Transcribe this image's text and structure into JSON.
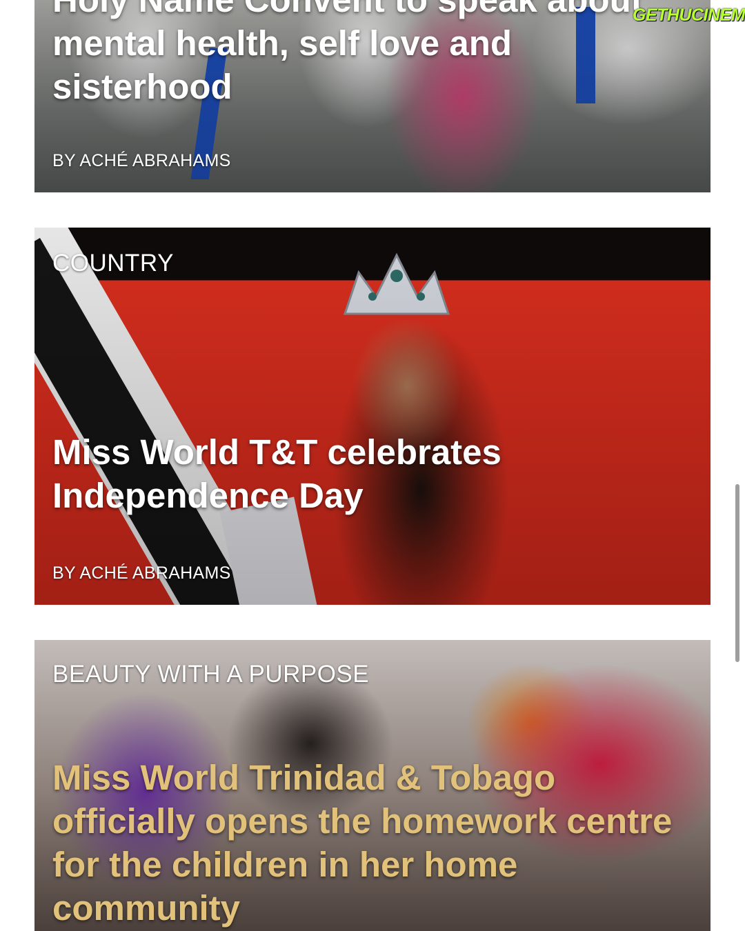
{
  "watermark": {
    "part1": "GETHU",
    "part2": "CINEMA",
    "color": "#b8ff2f"
  },
  "articles": [
    {
      "kicker": "",
      "title": "Holy Name Convent to speak about mental health, self love and sisterhood",
      "byline": "BY ACHÉ ABRAHAMS"
    },
    {
      "kicker": "COUNTRY",
      "title": "Miss World T&T celebrates Independence Day",
      "byline": "BY ACHÉ ABRAHAMS"
    },
    {
      "kicker": "BEAUTY WITH A PURPOSE",
      "title": "Miss World Trinidad & Tobago officially opens the homework centre for the children in her home community",
      "byline": "",
      "title_color": "#e2c27a"
    }
  ],
  "scrollbar": {
    "position_fraction": 0.62
  }
}
